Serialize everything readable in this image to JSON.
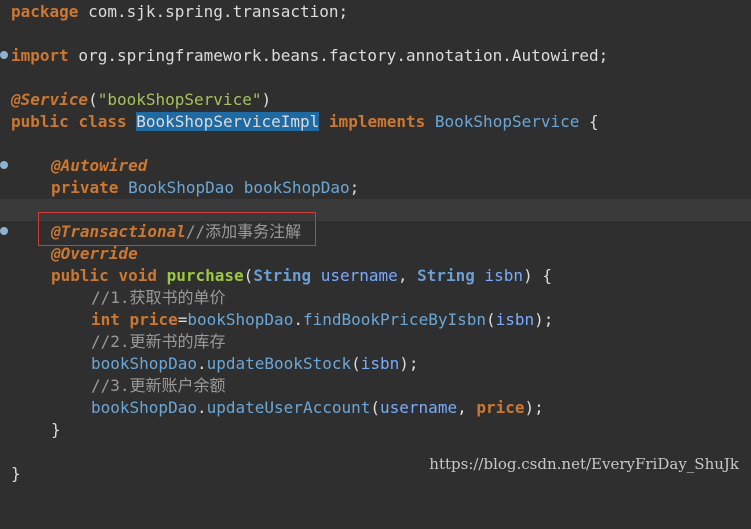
{
  "editor": {
    "line_pkg": {
      "kw": "package",
      "rest": " com.sjk.spring.transaction;"
    },
    "line_import": {
      "kw": "import",
      "rest": " org.springframework.beans.factory.annotation.Autowired;"
    },
    "line_service": {
      "ann": "@Service",
      "open": "(",
      "str": "\"bookShopService\"",
      "close": ")"
    },
    "line_class": {
      "kw1": "public",
      "kw2": "class",
      "name": "BookShopServiceImpl",
      "kw3": "implements",
      "iface": "BookShopService",
      "brace": "{"
    },
    "line_autowired": {
      "ann": "@Autowired"
    },
    "line_field": {
      "kw": "private",
      "type": "BookShopDao",
      "name": "bookShopDao",
      "semi": ";"
    },
    "line_transactional": {
      "ann": "@Transactional",
      "comment": "//添加事务注解"
    },
    "line_override": {
      "ann": "@Override"
    },
    "line_method": {
      "kw1": "public",
      "kw2": "void",
      "name": "purchase",
      "p1": "(",
      "t1": "String",
      "a1": "username",
      "comma": ",",
      "t2": "String",
      "a2": "isbn",
      "end": ") {"
    },
    "c1": "//1.获取书的单价",
    "line_price": {
      "kw": "int",
      "var": "price",
      "eq": "=",
      "obj": "bookShopDao",
      "dot": ".",
      "call": "findBookPriceByIsbn",
      "open": "(",
      "arg": "isbn",
      "close": ");"
    },
    "c2": "//2.更新书的库存",
    "line_stock": {
      "obj": "bookShopDao",
      "dot": ".",
      "call": "updateBookStock",
      "open": "(",
      "arg": "isbn",
      "close": ");"
    },
    "c3": "//3.更新账户余额",
    "line_account": {
      "obj": "bookShopDao",
      "dot": ".",
      "call": "updateUserAccount",
      "open": "(",
      "arg1": "username",
      "comma": ",",
      "arg2": "price",
      "close": ");"
    },
    "method_close": "}",
    "class_close": "}"
  },
  "watermark": "https://blog.csdn.net/EveryFriDay_ShuJk",
  "colors": {
    "background": "#2f2f2f",
    "keyword": "#cc7832",
    "highlight_box": "#d33b3b",
    "selection": "#1f6aa3"
  }
}
